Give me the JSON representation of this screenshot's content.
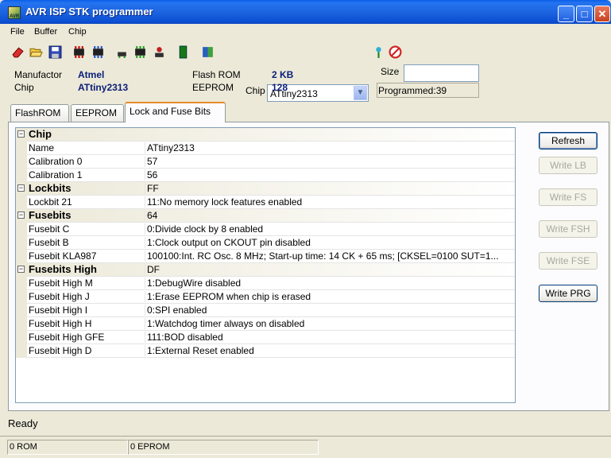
{
  "window": {
    "title": "AVR ISP STK programmer"
  },
  "menu": [
    "File",
    "Buffer",
    "Chip"
  ],
  "toolbar": {
    "chip_label": "Chip",
    "chip_selected": "ATtiny2313"
  },
  "info": {
    "manufactor_label": "Manufactor",
    "manufactor_value": "Atmel",
    "chip_label": "Chip",
    "chip_value": "ATtiny2313",
    "flash_label": "Flash ROM",
    "flash_value": "2 KB",
    "eeprom_label": "EEPROM",
    "eeprom_value": "128",
    "size_label": "Size",
    "size_value": "",
    "programmed": "Programmed:39"
  },
  "tabs": [
    "FlashROM",
    "EEPROM",
    "Lock and Fuse Bits"
  ],
  "grid": [
    {
      "cat": true,
      "name": "Chip",
      "value": ""
    },
    {
      "name": "Name",
      "value": "ATtiny2313"
    },
    {
      "name": "Calibration 0",
      "value": "57"
    },
    {
      "name": "Calibration 1",
      "value": "56"
    },
    {
      "cat": true,
      "name": "Lockbits",
      "value": "FF"
    },
    {
      "name": "Lockbit 21",
      "value": "11:No memory lock features enabled"
    },
    {
      "cat": true,
      "name": "Fusebits",
      "value": "64"
    },
    {
      "name": "Fusebit C",
      "value": "0:Divide clock by 8 enabled"
    },
    {
      "name": "Fusebit B",
      "value": "1:Clock output on CKOUT pin disabled"
    },
    {
      "name": "Fusebit KLA987",
      "value": "100100:Int. RC Osc. 8 MHz; Start-up time: 14 CK + 65 ms; [CKSEL=0100 SUT=1..."
    },
    {
      "cat": true,
      "name": "Fusebits High",
      "value": "DF"
    },
    {
      "name": "Fusebit High M",
      "value": "1:DebugWire disabled"
    },
    {
      "name": "Fusebit High J",
      "value": "1:Erase EEPROM when chip is erased"
    },
    {
      "name": "Fusebit High I",
      "value": "0:SPI enabled"
    },
    {
      "name": "Fusebit High H",
      "value": "1:Watchdog timer always on disabled"
    },
    {
      "name": "Fusebit High GFE",
      "value": "111:BOD disabled"
    },
    {
      "name": "Fusebit High D",
      "value": "1:External Reset enabled"
    }
  ],
  "buttons": {
    "refresh": "Refresh",
    "write_lb": "Write LB",
    "write_fs": "Write FS",
    "write_fsh": "Write FSH",
    "write_fse": "Write FSE",
    "write_prg": "Write PRG"
  },
  "status": {
    "text": "Ready",
    "rom": "0 ROM",
    "eprom": "0 EPROM"
  }
}
